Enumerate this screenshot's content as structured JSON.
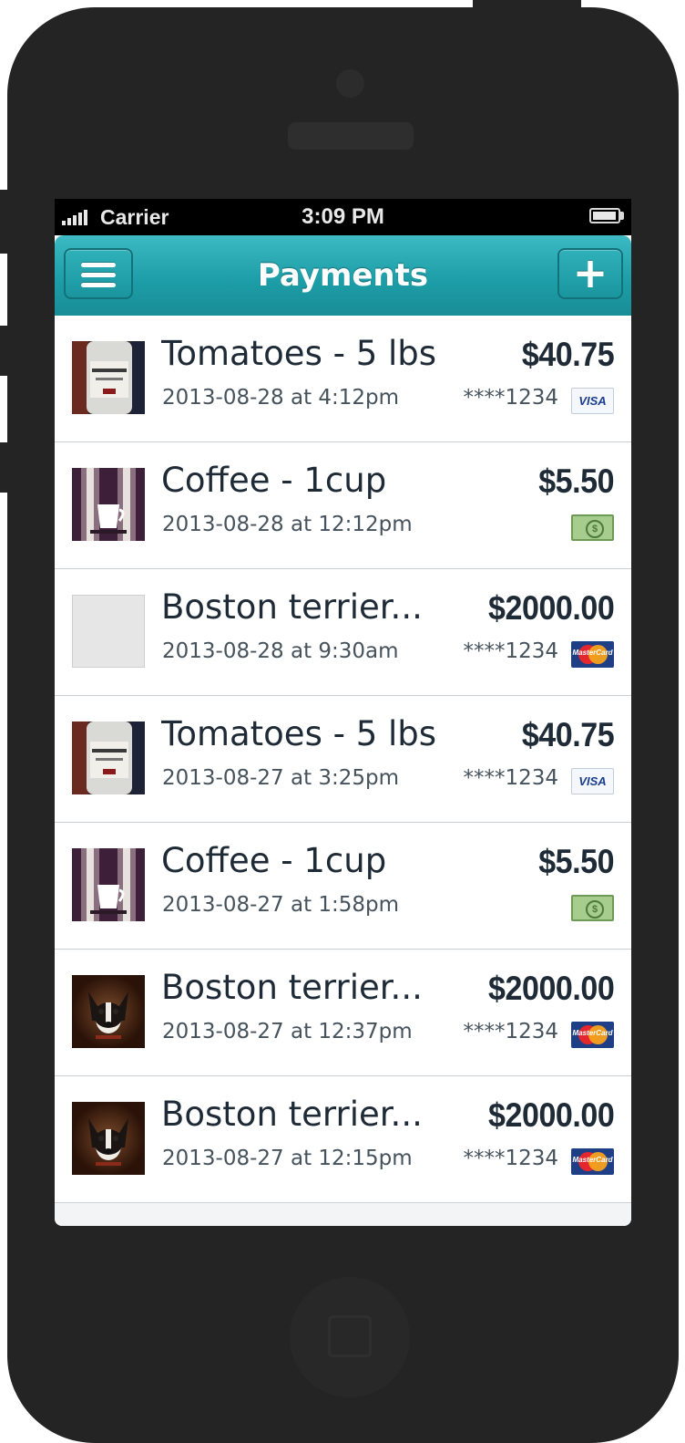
{
  "status_bar": {
    "carrier": "Carrier",
    "time": "3:09 PM"
  },
  "nav": {
    "title": "Payments",
    "menu_icon": "hamburger-menu-icon",
    "add_icon": "plus-icon",
    "add_glyph": "+"
  },
  "payments": [
    {
      "title": "Tomatoes - 5 lbs",
      "date": "2013-08-28 at 4:12pm",
      "amount": "$40.75",
      "card": "****1234",
      "method": "visa",
      "method_label": "VISA",
      "thumb": "whisky-bottle-photo"
    },
    {
      "title": "Coffee - 1cup",
      "date": "2013-08-28 at 12:12pm",
      "amount": "$5.50",
      "card": "",
      "method": "cash",
      "method_label": "$",
      "thumb": "coffee-cup-photo"
    },
    {
      "title": "Boston terrier...",
      "date": "2013-08-28 at 9:30am",
      "amount": "$2000.00",
      "card": "****1234",
      "method": "mastercard",
      "method_label": "MasterCard",
      "thumb": "blank-placeholder"
    },
    {
      "title": "Tomatoes - 5 lbs",
      "date": "2013-08-27 at 3:25pm",
      "amount": "$40.75",
      "card": "****1234",
      "method": "visa",
      "method_label": "VISA",
      "thumb": "whisky-bottle-photo"
    },
    {
      "title": "Coffee - 1cup",
      "date": "2013-08-27 at 1:58pm",
      "amount": "$5.50",
      "card": "",
      "method": "cash",
      "method_label": "$",
      "thumb": "coffee-cup-photo"
    },
    {
      "title": "Boston terrier...",
      "date": "2013-08-27 at 12:37pm",
      "amount": "$2000.00",
      "card": "****1234",
      "method": "mastercard",
      "method_label": "MasterCard",
      "thumb": "dog-photo"
    },
    {
      "title": "Boston terrier...",
      "date": "2013-08-27 at 12:15pm",
      "amount": "$2000.00",
      "card": "****1234",
      "method": "mastercard",
      "method_label": "MasterCard",
      "thumb": "dog-photo"
    }
  ],
  "colors": {
    "nav_accent": "#1d9ea8",
    "text_dark": "#1e2a36",
    "text_muted": "#46525c",
    "phone_body": "#242424"
  }
}
